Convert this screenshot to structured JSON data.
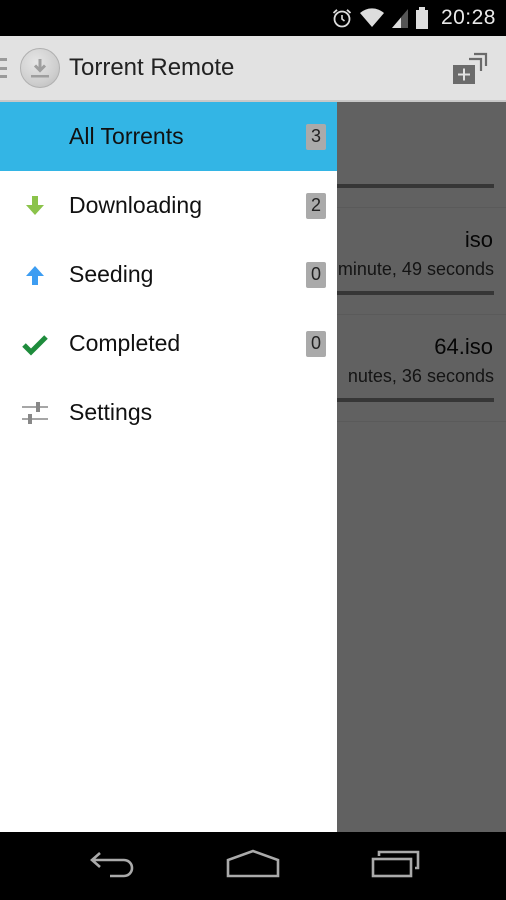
{
  "status_bar": {
    "time": "20:28",
    "icons": [
      "alarm-icon",
      "wifi-icon",
      "cell-signal-icon",
      "battery-icon"
    ]
  },
  "action_bar": {
    "title": "Torrent Remote",
    "logo_icon": "download-circle-icon",
    "action_icon": "add-torrent-stack-icon"
  },
  "drawer": {
    "items": [
      {
        "label": "All Torrents",
        "count": "3",
        "icon": "none",
        "active": true
      },
      {
        "label": "Downloading",
        "count": "2",
        "icon": "arrow-down-icon",
        "color": "#8bc34a"
      },
      {
        "label": "Seeding",
        "count": "0",
        "icon": "arrow-up-icon",
        "color": "#3d9df2"
      },
      {
        "label": "Completed",
        "count": "0",
        "icon": "checkmark-icon",
        "color": "#1e8c3c"
      },
      {
        "label": "Settings",
        "icon": "sliders-icon",
        "color": "#777777"
      }
    ]
  },
  "background_list": {
    "torrents": [
      {
        "name_visible": "",
        "eta_visible": ""
      },
      {
        "name_visible": "iso",
        "eta_visible": "minute, 49 seconds"
      },
      {
        "name_visible": "64.iso",
        "eta_visible": "nutes, 36 seconds"
      }
    ]
  },
  "nav_bar": {
    "buttons": [
      "back-icon",
      "home-icon",
      "recent-apps-icon"
    ]
  },
  "colors": {
    "accent": "#33b5e5",
    "badge": "#aaaaaa",
    "action_bar": "#e2e2e2"
  }
}
